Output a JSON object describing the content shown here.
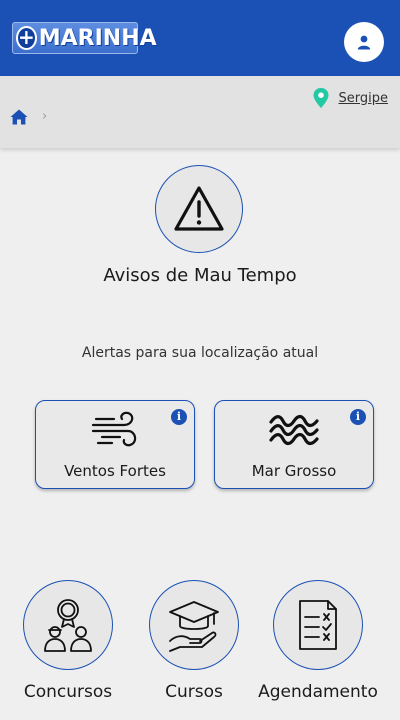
{
  "header": {
    "logo_text": "MARINHA",
    "brand_color": "#1b51b5",
    "avatar_icon": "user-icon"
  },
  "breadcrumb": {
    "home_icon": "home-icon",
    "separator": "›",
    "location_icon": "map-pin-icon",
    "location": "Sergipe"
  },
  "main": {
    "icon": "warning-triangle-icon",
    "title": "Avisos de Mau Tempo",
    "subtitle": "Alertas para sua localização atual",
    "alerts": [
      {
        "label": "Ventos Fortes",
        "icon": "wind-icon",
        "info_icon": "info-icon"
      },
      {
        "label": "Mar Grosso",
        "icon": "waves-icon",
        "info_icon": "info-icon"
      }
    ]
  },
  "bottom_nav": [
    {
      "label": "Concursos",
      "icon": "medal-people-icon"
    },
    {
      "label": "Cursos",
      "icon": "graduation-cap-icon"
    },
    {
      "label": "Agendamento",
      "icon": "checklist-document-icon"
    }
  ]
}
